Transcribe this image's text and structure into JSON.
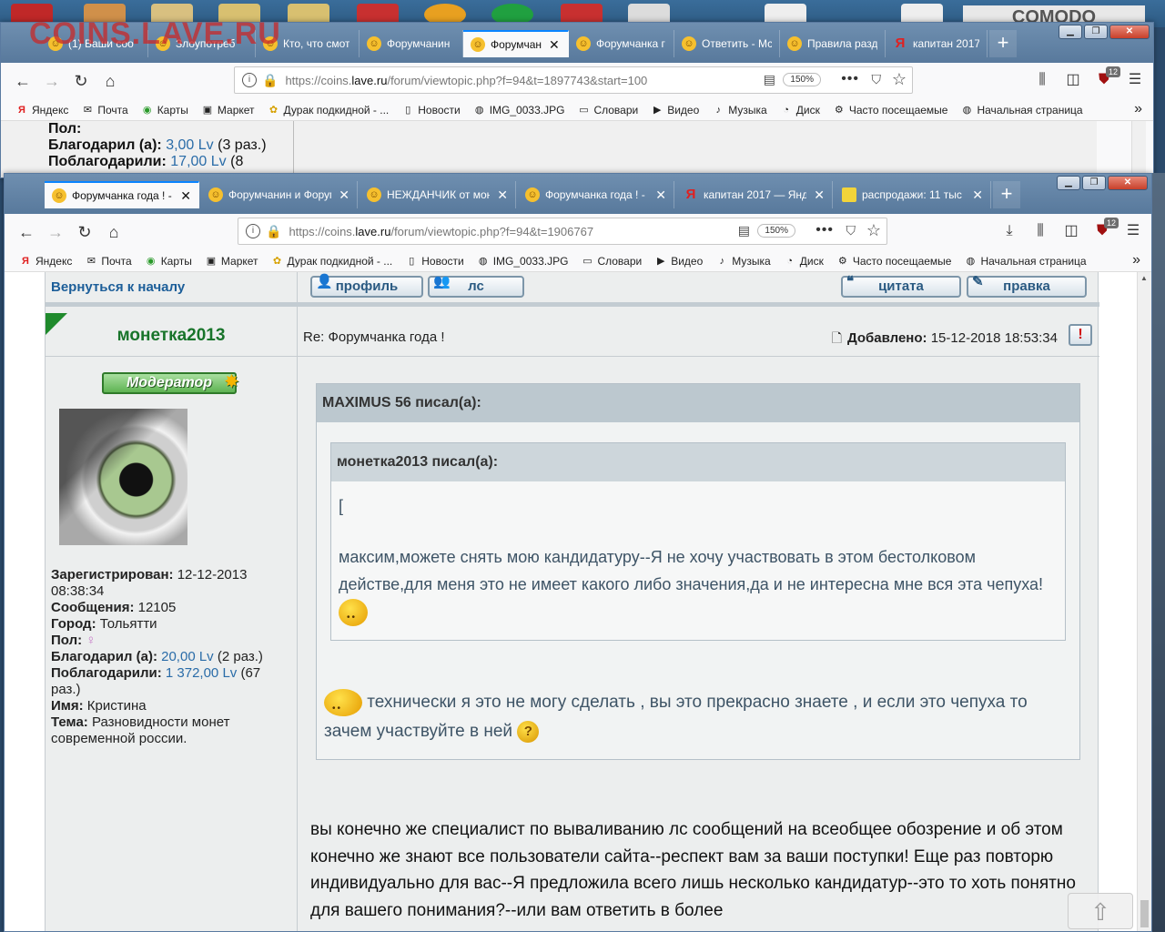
{
  "desktop": {
    "watermark": "COINS.LAVE.RU",
    "comodo": "COMODO"
  },
  "back_window": {
    "tabs": [
      {
        "label": "(1) Ваши соо",
        "icon": "smiley-icon"
      },
      {
        "label": "Злоупотреб",
        "icon": "smiley-icon"
      },
      {
        "label": "Кто, что смот",
        "icon": "smiley-icon"
      },
      {
        "label": "Форумчанин",
        "icon": "smiley-icon"
      },
      {
        "label": "Форумчан",
        "icon": "smiley-icon",
        "active": true
      },
      {
        "label": "Форумчанка г",
        "icon": "smiley-icon"
      },
      {
        "label": "Ответить - Мс",
        "icon": "smiley-icon"
      },
      {
        "label": "Правила разд",
        "icon": "smiley-icon"
      },
      {
        "label": "капитан 2017",
        "icon": "yandex-icon"
      }
    ],
    "url_host": "https://coins.",
    "url_domain": "lave.ru",
    "url_path": "/forum/viewtopic.php?f=94&t=1897743&start=100",
    "zoom": "150%",
    "badge": "12",
    "profile_lines": {
      "pol_label": "Пол:",
      "thanked_label": "Благодарил (а):",
      "thanked_value": "3,00 Lv",
      "thanked_count": "(3 раз.)",
      "thanks_label": "Поблагодарили:",
      "thanks_value": "17,00 Lv",
      "thanks_count": "(8"
    }
  },
  "front_window": {
    "tabs": [
      {
        "label": "Форумчанка года ! - Ф",
        "icon": "smiley-icon",
        "active": true
      },
      {
        "label": "Форумчанин и Форумч",
        "icon": "smiley-icon"
      },
      {
        "label": "НЕЖДАНЧИК от моне",
        "icon": "smiley-icon"
      },
      {
        "label": "Форумчанка года ! - Ф",
        "icon": "smiley-icon"
      },
      {
        "label": "капитан 2017 — Яндек",
        "icon": "yandex-icon"
      },
      {
        "label": "распродажи: 11 тыс т",
        "icon": "sale-icon"
      }
    ],
    "url_host": "https://coins.",
    "url_domain": "lave.ru",
    "url_path": "/forum/viewtopic.php?f=94&t=1906767",
    "zoom": "150%",
    "badge": "12"
  },
  "bookmarks": [
    "Яндекс",
    "Почта",
    "Карты",
    "Маркет",
    "Дурак подкидной - ...",
    "Новости",
    "IMG_0033.JPG",
    "Словари",
    "Видео",
    "Музыка",
    "Диск",
    "Часто посещаемые",
    "Начальная страница"
  ],
  "forum": {
    "back_to_top": "Вернуться к началу",
    "btn_profile": "профиль",
    "btn_pm": "лс",
    "btn_quote": "цитата",
    "btn_edit": "правка",
    "username": "монетка2013",
    "subject": "Re: Форумчанка года !",
    "added_label": "Добавлено:",
    "added_value": "15-12-2018 18:53:34",
    "report": "!",
    "moderator_badge": "Модератор",
    "profile": {
      "registered_label": "Зарегистрирован:",
      "registered_value": "12-12-2013 08:38:34",
      "messages_label": "Сообщения:",
      "messages_value": "12105",
      "city_label": "Город:",
      "city_value": "Тольятти",
      "gender_label": "Пол:",
      "thanked_label": "Благодарил (а):",
      "thanked_value": "20,00 Lv",
      "thanked_count": "(2 раз.)",
      "thanks_label": "Поблагодарили:",
      "thanks_value": "1 372,00 Lv",
      "thanks_count": "(67 раз.)",
      "name_label": "Имя:",
      "name_value": "Кристина",
      "topic_label": "Тема:",
      "topic_value": "Разновидности монет современной россии."
    },
    "quote_outer_author": "MAXIMUS 56 писал(а):",
    "quote_inner_author": "монетка2013 писал(а):",
    "quote_inner_bracket": "[",
    "quote_inner_text": "максим,можете снять мою кандидатуру--Я не хочу участвовать в этом бестолковом действе,для меня это не имеет какого либо значения,да и не интересна мне вся эта чепуха!",
    "quote_outer_reply": "технически я это не могу сделать , вы это прекрасно знаете , и если это чепуха то зачем участвуйте в ней",
    "question_mark": "?",
    "main_reply": "вы конечно же специалист по вываливанию лс сообщений на всеобщее обозрение и об этом конечно же знают все пользователи сайта--респект вам за ваши поступки! Еще раз повторю индивидуально для вас--Я предложила всего лишь несколько кандидатур--это то хоть понятно для вашего понимания?--или вам ответить в более"
  },
  "colors": {
    "accent": "#0a84ff",
    "username_green": "#18742a",
    "link_blue": "#2a6ca8",
    "quote_text": "#3e5466"
  }
}
